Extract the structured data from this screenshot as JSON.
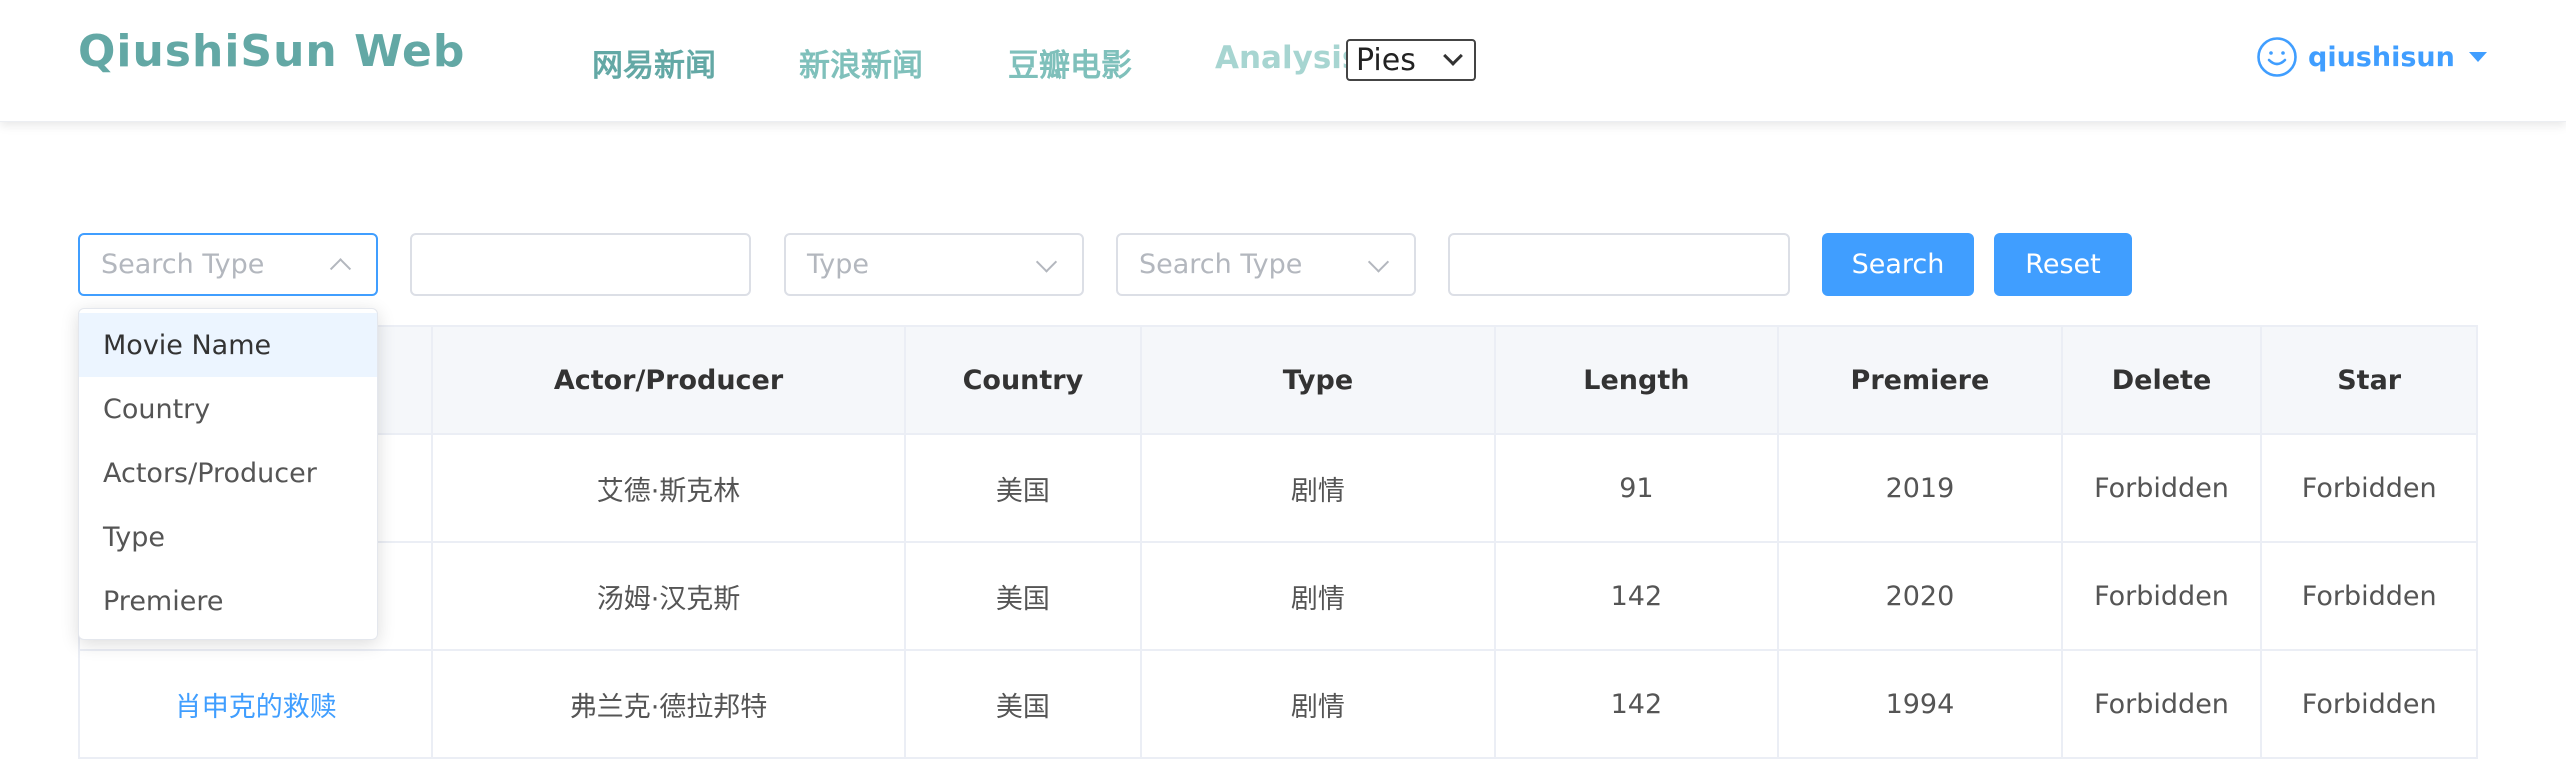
{
  "header": {
    "brand": "QiushiSun Web",
    "nav": [
      "网易新闻",
      "新浪新闻",
      "豆瓣电影",
      "Analysis"
    ],
    "analysis_select_value": "Pies",
    "username": "qiushisun"
  },
  "filters": {
    "search_type_1": {
      "placeholder": "Search Type",
      "expanded": true
    },
    "text_1": {
      "value": ""
    },
    "type": {
      "placeholder": "Type"
    },
    "search_type_2": {
      "placeholder": "Search Type"
    },
    "text_2": {
      "value": ""
    }
  },
  "buttons": {
    "search": "Search",
    "reset": "Reset"
  },
  "dropdown": {
    "options": [
      "Movie Name",
      "Country",
      "Actors/Producer",
      "Type",
      "Premiere"
    ],
    "highlighted": "Movie Name"
  },
  "table": {
    "columns": [
      "",
      "Actor/Producer",
      "Country",
      "Type",
      "Length",
      "Premiere",
      "Delete",
      "Star"
    ],
    "rows": [
      {
        "movie": "",
        "actor": "艾德·斯克林",
        "country": "美国",
        "type": "剧情",
        "length": "91",
        "premiere": "2019",
        "delete": "Forbidden",
        "star": "Forbidden"
      },
      {
        "movie": "",
        "actor": "汤姆·汉克斯",
        "country": "美国",
        "type": "剧情",
        "length": "142",
        "premiere": "2020",
        "delete": "Forbidden",
        "star": "Forbidden"
      },
      {
        "movie": "肖申克的救赎",
        "actor": "弗兰克·德拉邦特",
        "country": "美国",
        "type": "剧情",
        "length": "142",
        "premiere": "1994",
        "delete": "Forbidden",
        "star": "Forbidden"
      }
    ]
  },
  "colors": {
    "brand": "#63a8a5",
    "nav": "#7fc0bb",
    "accent": "#409eff",
    "dropdown_hover": "#ecf5ff"
  }
}
